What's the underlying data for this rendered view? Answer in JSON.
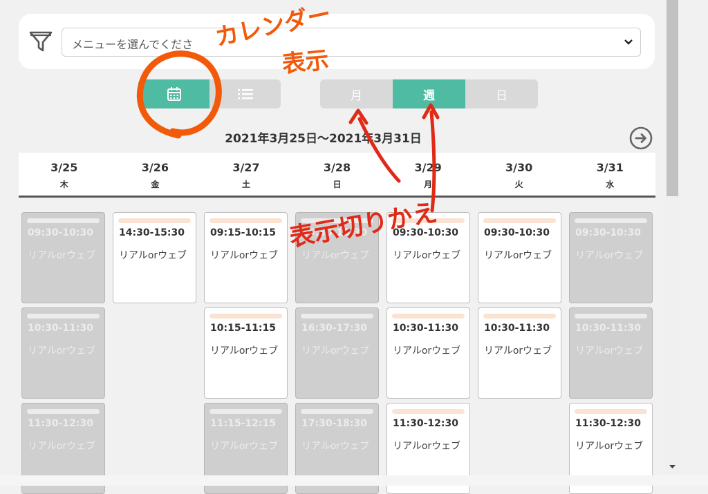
{
  "filter": {
    "icon": "filter-icon",
    "placeholder": "メニューを選んでくださ"
  },
  "view_toggle": {
    "calendar_icon": "calendar-icon",
    "list_icon": "list-icon",
    "active": "calendar"
  },
  "range_tabs": {
    "month": "月",
    "week": "週",
    "day": "日",
    "active": "week"
  },
  "date_range": "2021年3月25日～2021年3月31日",
  "next_icon": "arrow-right-circle-icon",
  "days": [
    {
      "date": "3/25",
      "weekday": "木"
    },
    {
      "date": "3/26",
      "weekday": "金"
    },
    {
      "date": "3/27",
      "weekday": "土"
    },
    {
      "date": "3/28",
      "weekday": "日"
    },
    {
      "date": "3/29",
      "weekday": "月"
    },
    {
      "date": "3/30",
      "weekday": "火"
    },
    {
      "date": "3/31",
      "weekday": "水"
    }
  ],
  "slots": {
    "d0": [
      {
        "time": "09:30-10:30",
        "label": "リアルorウェブ",
        "state": "full"
      },
      {
        "time": "10:30-11:30",
        "label": "リアルorウェブ",
        "state": "full"
      },
      {
        "time": "11:30-12:30",
        "label": "リアルorウェブ",
        "state": "full"
      }
    ],
    "d1": [
      {
        "time": "14:30-15:30",
        "label": "リアルorウェブ",
        "state": "open"
      }
    ],
    "d2": [
      {
        "time": "09:15-10:15",
        "label": "リアルorウェブ",
        "state": "open"
      },
      {
        "time": "10:15-11:15",
        "label": "リアルorウェブ",
        "state": "open"
      },
      {
        "time": "11:15-12:15",
        "label": "リアルorウェブ",
        "state": "full"
      }
    ],
    "d3": [
      {
        "time": "15:30-16:30",
        "label": "リアルorウェブ",
        "state": "full"
      },
      {
        "time": "16:30-17:30",
        "label": "リアルorウェブ",
        "state": "full"
      },
      {
        "time": "17:30-18:30",
        "label": "リアルorウェブ",
        "state": "full"
      }
    ],
    "d4": [
      {
        "time": "09:30-10:30",
        "label": "リアルorウェブ",
        "state": "open"
      },
      {
        "time": "10:30-11:30",
        "label": "リアルorウェブ",
        "state": "open"
      },
      {
        "time": "11:30-12:30",
        "label": "リアルorウェブ",
        "state": "open"
      }
    ],
    "d5": [
      {
        "time": "09:30-10:30",
        "label": "リアルorウェブ",
        "state": "open"
      },
      {
        "time": "10:30-11:30",
        "label": "リアルorウェブ",
        "state": "open"
      }
    ],
    "d6": [
      {
        "time": "09:30-10:30",
        "label": "リアルorウェブ",
        "state": "full"
      },
      {
        "time": "10:30-11:30",
        "label": "リアルorウェブ",
        "state": "full"
      },
      {
        "time": "11:30-12:30",
        "label": "リアルorウェブ",
        "state": "open"
      }
    ]
  },
  "annotations": {
    "calendar_display": "カレンダー表示",
    "calendar_display_line1": "カレンダー",
    "calendar_display_line2": "表示",
    "display_switch": "表示切りかえ",
    "color": "#e02a18",
    "circle_color": "#f25a0a"
  },
  "colors": {
    "accent": "#4fbba3",
    "inactive": "#d9d9d9",
    "full_slot": "#cfcfcf",
    "slot_bar": "#fbe3d3"
  }
}
